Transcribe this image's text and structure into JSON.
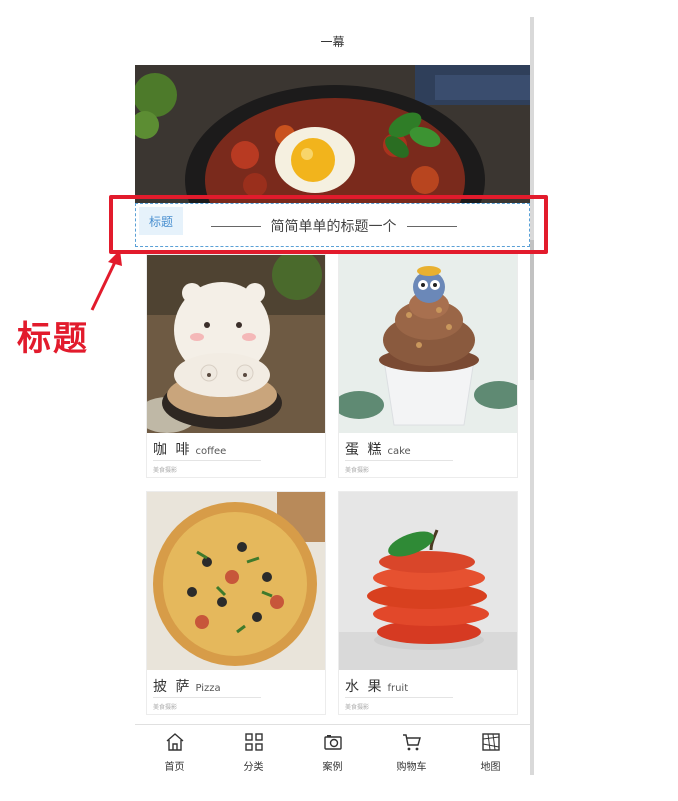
{
  "header": {
    "title": "一幕"
  },
  "title_bar": {
    "tag": "标题",
    "text": "简简单单的标题一个"
  },
  "cards": [
    {
      "name": "咖 啡",
      "en": "coffee",
      "sub": "美食摄影"
    },
    {
      "name": "蛋 糕",
      "en": "cake",
      "sub": "美食摄影"
    },
    {
      "name": "披 萨",
      "en": "Pizza",
      "sub": "美食摄影"
    },
    {
      "name": "水 果",
      "en": "fruit",
      "sub": "美食摄影"
    }
  ],
  "nav": [
    {
      "label": "首页",
      "icon": "home-icon"
    },
    {
      "label": "分类",
      "icon": "grid-icon"
    },
    {
      "label": "案例",
      "icon": "camera-icon"
    },
    {
      "label": "购物车",
      "icon": "cart-icon"
    },
    {
      "label": "地图",
      "icon": "map-icon"
    }
  ],
  "annotation": {
    "label": "标题",
    "color": "#e21b2c"
  },
  "colors": {
    "accent": "#4a90d0",
    "highlight": "#e21b2c"
  }
}
